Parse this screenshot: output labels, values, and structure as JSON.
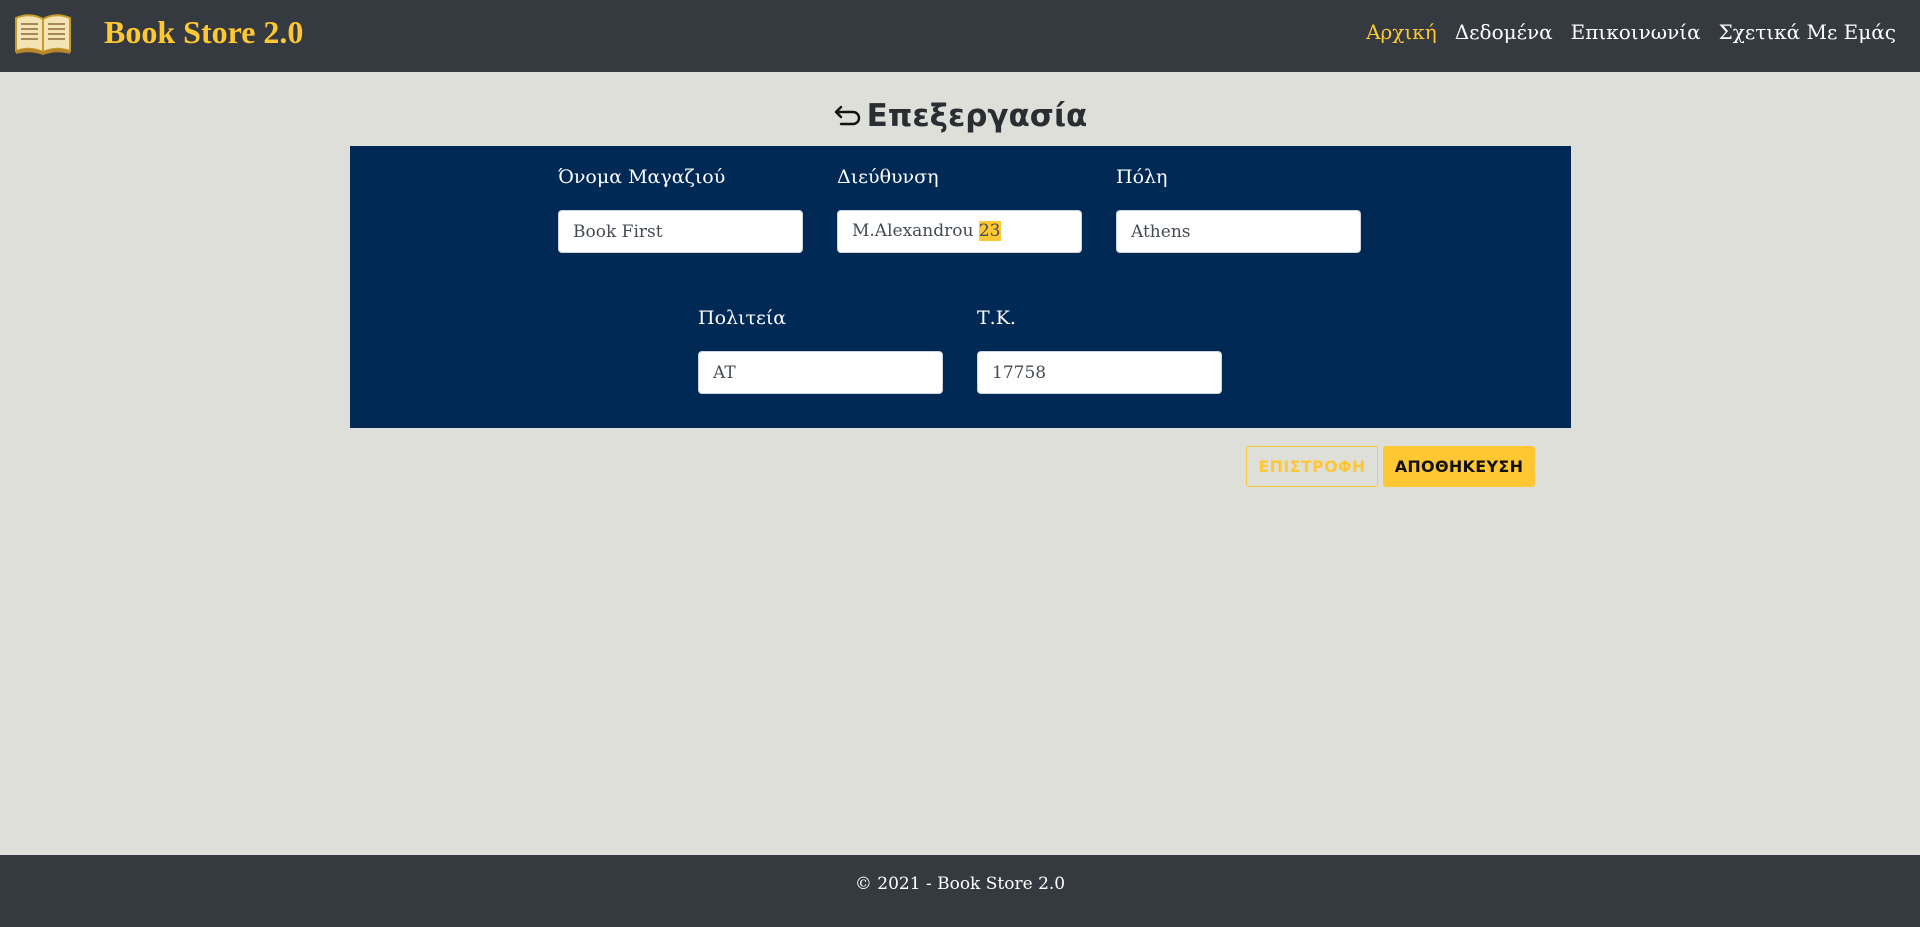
{
  "header": {
    "brand": "Book Store 2.0",
    "logo_icon": "open-book-icon",
    "nav": [
      {
        "label": "Αρχική",
        "active": true
      },
      {
        "label": "Δεδομένα",
        "active": false
      },
      {
        "label": "Επικοινωνία",
        "active": false
      },
      {
        "label": "Σχετικά Με Εμάς",
        "active": false
      }
    ]
  },
  "page": {
    "title": "Επεξεργασία",
    "back_icon": "return-arrow-icon"
  },
  "form": {
    "store_name": {
      "label": "Όνομα Μαγαζιού",
      "value": "Book First"
    },
    "address": {
      "label": "Διεύθυνση",
      "value_prefix": "M.Alexandrou ",
      "value_highlight": "23"
    },
    "city": {
      "label": "Πόλη",
      "value": "Athens"
    },
    "state": {
      "label": "Πολιτεία",
      "value": "AT"
    },
    "zip": {
      "label": "Τ.Κ.",
      "value": "17758"
    }
  },
  "actions": {
    "back_label": "ΕΠΙΣΤΡΟΦΗ",
    "save_label": "ΑΠΟΘΗΚΕΥΣΗ"
  },
  "footer": {
    "text": "© 2021 - Book Store 2.0"
  },
  "colors": {
    "accent": "#ffc832",
    "navbar": "#343a40",
    "panel": "#002a55",
    "background": "#dedfd9"
  }
}
